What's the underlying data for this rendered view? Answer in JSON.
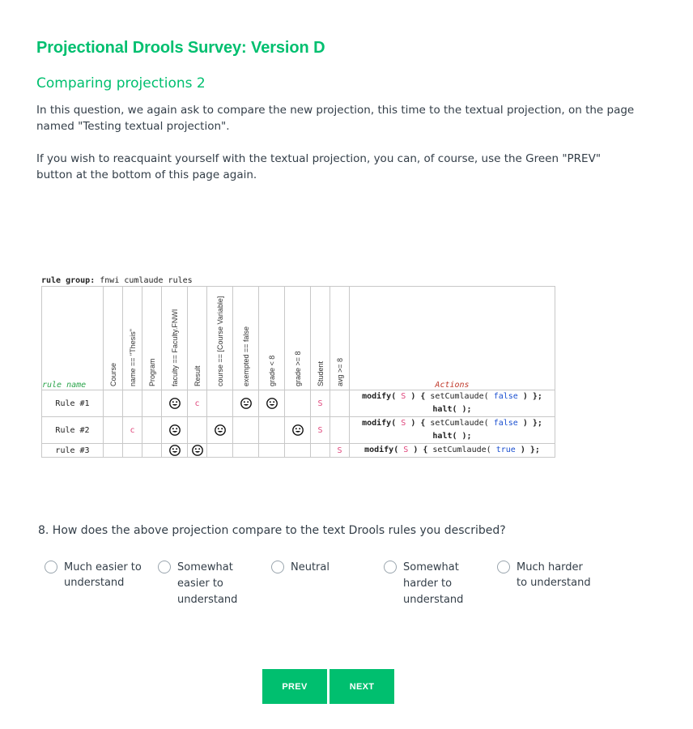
{
  "survey": {
    "title": "Projectional Drools Survey: Version D"
  },
  "page": {
    "title": "Comparing projections 2",
    "intro_1": "In this question, we again ask to compare the new projection, this time to the textual projection, on the page named \"Testing textual projection\".",
    "intro_2": "If you wish to reacquaint yourself with the textual projection, you can, of course, use the Green \"PREV\" button at the bottom of this page again."
  },
  "rule_table": {
    "group_label": "rule group:",
    "group_name": "fnwi cumlaude rules",
    "rule_name_header": "rule name",
    "actions_header": "Actions",
    "columns": [
      "Course",
      "name == \"Thesis\"",
      "Program",
      "faculty == Faculty.FNWI",
      "Result",
      "course == [Course Variable]",
      "exempted == false",
      "grade < 8",
      "grade >= 8",
      "Student",
      "avg >= 8"
    ],
    "rows": [
      {
        "name": "Rule #1",
        "cells": [
          "",
          "",
          "",
          "smiley",
          "c",
          "",
          "smiley",
          "smiley",
          "",
          "S",
          ""
        ],
        "action_1": "modify( S ) { setCumlaude( false ) };",
        "action_2": "halt( );"
      },
      {
        "name": "Rule #2",
        "cells": [
          "",
          "c",
          "",
          "smiley",
          "",
          "smiley",
          "",
          "",
          "smiley",
          "S",
          ""
        ],
        "action_1": "modify( S ) { setCumlaude( false ) };",
        "action_2": "halt( );"
      },
      {
        "name": "rule #3",
        "cells": [
          "",
          "",
          "",
          "smiley",
          "smiley",
          "",
          "",
          "",
          "",
          "",
          "S"
        ],
        "action_1": "modify( S ) { setCumlaude( true ) };",
        "action_2": ""
      }
    ],
    "action_words": {
      "modify": "modify(",
      "set": "setCumlaude(",
      "close": ") };",
      "halt": "halt( );",
      "var": "S",
      "false": "false",
      "true": "true"
    }
  },
  "question": {
    "text": "8. How does the above projection compare to the text Drools rules you described?",
    "options": [
      {
        "l1": "Much easier to",
        "l2": "understand",
        "l3": ""
      },
      {
        "l1": "Somewhat",
        "l2": "easier to",
        "l3": "understand"
      },
      {
        "l1": "Neutral",
        "l2": "",
        "l3": ""
      },
      {
        "l1": "Somewhat",
        "l2": "harder to",
        "l3": "understand"
      },
      {
        "l1": "Much harder",
        "l2": "to understand",
        "l3": ""
      }
    ]
  },
  "nav": {
    "prev": "PREV",
    "next": "NEXT"
  },
  "colors": {
    "accent": "#00bf6f",
    "text": "#333e48",
    "rule_name": "#2aa44a",
    "actions": "#c0392b",
    "variable": "#e0457b",
    "literal": "#1a4fd0"
  }
}
